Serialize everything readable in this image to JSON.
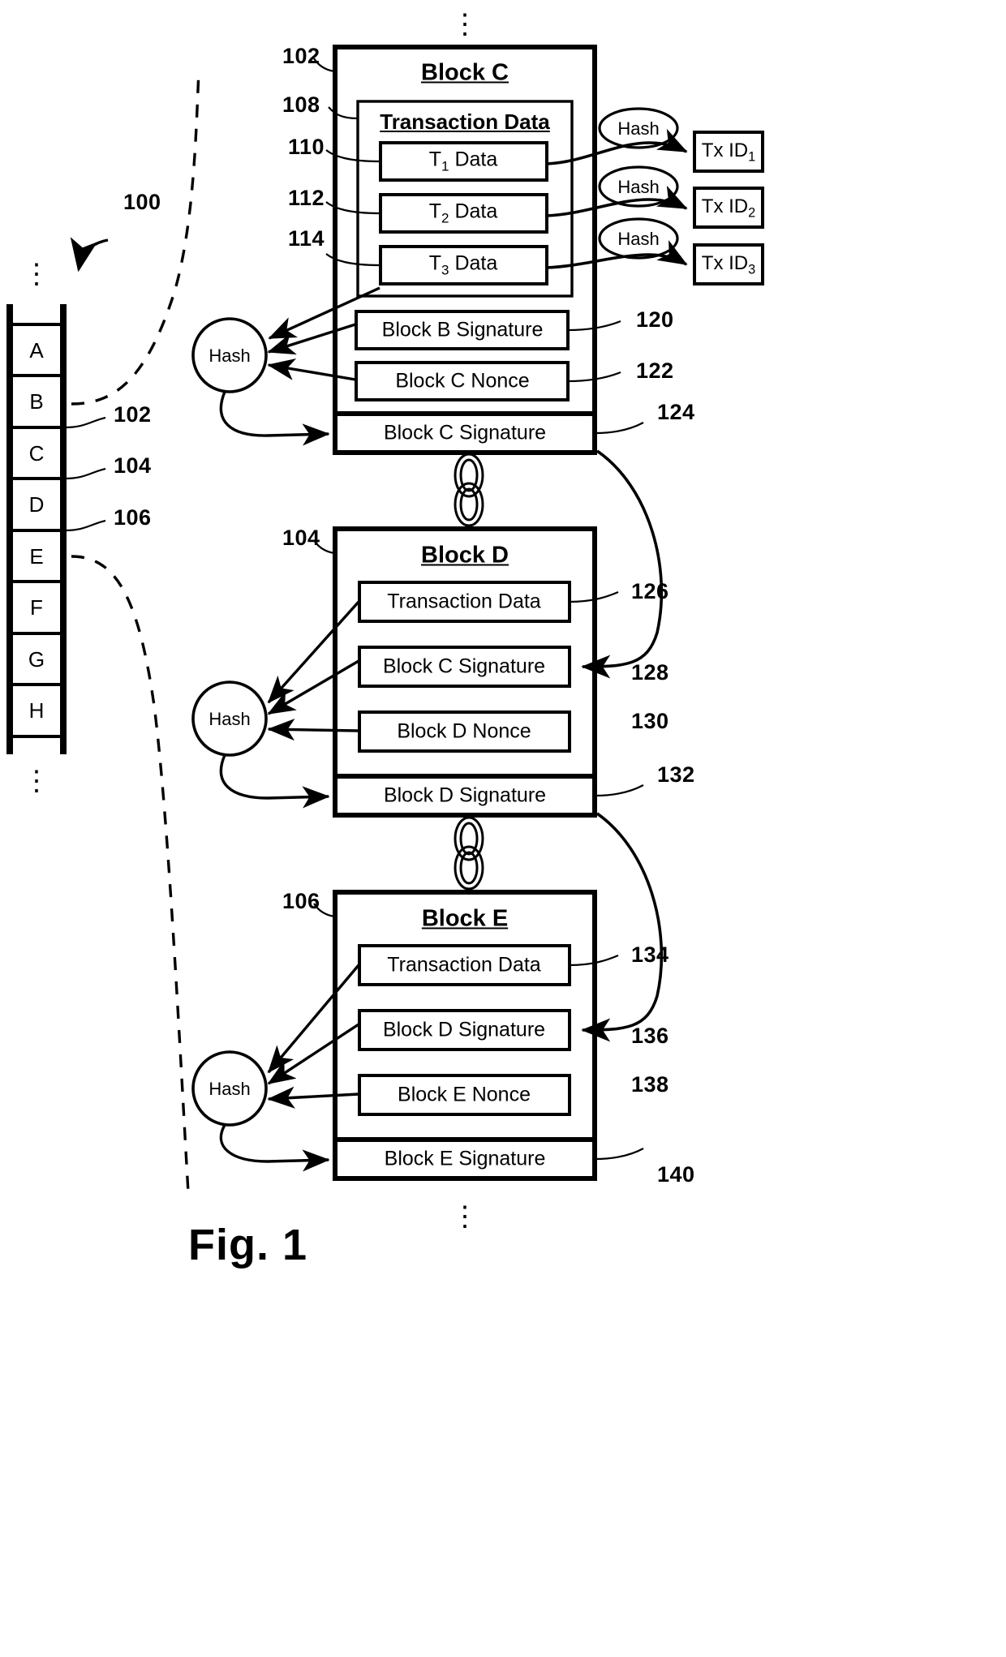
{
  "figure": {
    "caption": "Fig. 1",
    "system_ref": "100"
  },
  "chain_column": {
    "name": "blockchain-column",
    "top_ellipsis": "⋮",
    "bottom_ellipsis": "⋮",
    "cells": [
      {
        "label": "A",
        "ref": ""
      },
      {
        "label": "B",
        "ref": ""
      },
      {
        "label": "C",
        "ref": "102"
      },
      {
        "label": "D",
        "ref": "104"
      },
      {
        "label": "E",
        "ref": "106"
      },
      {
        "label": "F",
        "ref": ""
      },
      {
        "label": "G",
        "ref": ""
      },
      {
        "label": "H",
        "ref": ""
      }
    ]
  },
  "top_ellipsis": "⋮",
  "bottom_ellipsis": "⋮",
  "block_c": {
    "title": "Block C",
    "ref": "102",
    "transaction_data": {
      "title": "Transaction Data",
      "ref": "108",
      "items": [
        {
          "prefix": "T",
          "sub": "1",
          "suffix": " Data",
          "ref": "110"
        },
        {
          "prefix": "T",
          "sub": "2",
          "suffix": " Data",
          "ref": "112"
        },
        {
          "prefix": "T",
          "sub": "3",
          "suffix": " Data",
          "ref": "114"
        }
      ]
    },
    "rows": [
      {
        "label": "Block B Signature",
        "ref": "120"
      },
      {
        "label": "Block C Nonce",
        "ref": "122"
      }
    ],
    "signature": {
      "label": "Block C Signature",
      "ref": "124"
    },
    "hash_node": "Hash",
    "tx_hashes": [
      {
        "hash": "Hash",
        "prefix": "Tx ID",
        "sub": "1"
      },
      {
        "hash": "Hash",
        "prefix": "Tx ID",
        "sub": "2"
      },
      {
        "hash": "Hash",
        "prefix": "Tx ID",
        "sub": "3"
      }
    ]
  },
  "block_d": {
    "title": "Block D",
    "ref": "104",
    "rows": [
      {
        "label": "Transaction Data",
        "ref": "126"
      },
      {
        "label": "Block C Signature",
        "ref": "128"
      },
      {
        "label": "Block D Nonce",
        "ref": "130"
      }
    ],
    "signature": {
      "label": "Block D Signature",
      "ref": "132"
    },
    "hash_node": "Hash"
  },
  "block_e": {
    "title": "Block E",
    "ref": "106",
    "rows": [
      {
        "label": "Transaction Data",
        "ref": "134"
      },
      {
        "label": "Block D Signature",
        "ref": "136"
      },
      {
        "label": "Block E Nonce",
        "ref": "138"
      }
    ],
    "signature": {
      "label": "Block E Signature",
      "ref": "140"
    },
    "hash_node": "Hash"
  },
  "icons": {
    "chain_link_c_d": "chain-link-icon",
    "chain_link_d_e": "chain-link-icon",
    "pointer_100": "arrow-pointer-icon"
  }
}
